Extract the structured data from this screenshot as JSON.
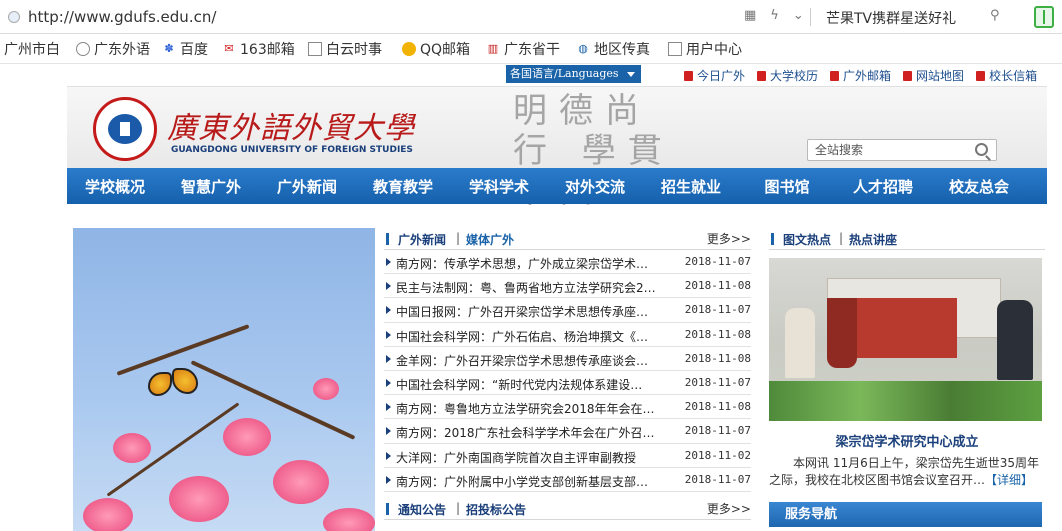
{
  "browser": {
    "url": "http://www.gdufs.edu.cn/",
    "tool_icons": [
      "grid-icon",
      "bolt-icon",
      "chevron-down-icon"
    ],
    "promo_text": "芒果TV携群星送好礼"
  },
  "bookmarks": [
    {
      "label": "广州市白",
      "icon": "page-icon"
    },
    {
      "label": "广东外语",
      "icon": "globe-icon"
    },
    {
      "label": "百度",
      "icon": "paw-icon"
    },
    {
      "label": "163邮箱",
      "icon": "mail163-icon"
    },
    {
      "label": "白云时事",
      "icon": "page-icon"
    },
    {
      "label": "QQ邮箱",
      "icon": "qq-icon"
    },
    {
      "label": "广东省干",
      "icon": "book-icon"
    },
    {
      "label": "地区传真",
      "icon": "swirl-icon"
    },
    {
      "label": "用户中心",
      "icon": "page-icon"
    }
  ],
  "site": {
    "lang_select": "各国语言/Languages",
    "toplinks": [
      "今日广外",
      "大学校历",
      "广外邮箱",
      "网站地图",
      "校长信箱"
    ],
    "logo_cn": "廣東外語外貿大學",
    "logo_en": "GUANGDONG UNIVERSITY OF FOREIGN STUDIES",
    "motto": "明德尚行 學貫中西",
    "search_placeholder": "全站搜索",
    "nav": [
      "学校概况",
      "智慧广外",
      "广外新闻",
      "教育教学",
      "学科学术",
      "对外交流",
      "招生就业",
      "图书馆",
      "人才招聘",
      "校友总会"
    ]
  },
  "news": {
    "tab1": "广外新闻",
    "tab2": "媒体广外",
    "more": "更多>>",
    "items": [
      {
        "title": "南方网：传承学术思想，广外成立梁宗岱学术…",
        "date": "2018-11-07"
      },
      {
        "title": "民主与法制网：粤、鲁两省地方立法学研究会2…",
        "date": "2018-11-08"
      },
      {
        "title": "中国日报网：广外召开梁宗岱学术思想传承座…",
        "date": "2018-11-07"
      },
      {
        "title": "中国社会科学网：广外石佑启、杨治坤撰文《…",
        "date": "2018-11-08"
      },
      {
        "title": "金羊网：广外召开梁宗岱学术思想传承座谈会…",
        "date": "2018-11-08"
      },
      {
        "title": "中国社会科学网：“新时代党内法规体系建设…",
        "date": "2018-11-07"
      },
      {
        "title": "南方网：粤鲁地方立法学研究会2018年年会在…",
        "date": "2018-11-08"
      },
      {
        "title": "南方网：2018广东社会科学学术年会在广外召…",
        "date": "2018-11-07"
      },
      {
        "title": "大洋网：广外南国商学院首次自主评审副教授",
        "date": "2018-11-02"
      },
      {
        "title": "南方网：广外附属中小学党支部创新基层支部…",
        "date": "2018-11-07"
      }
    ],
    "notice_tab1": "通知公告",
    "notice_tab2": "招投标公告",
    "notice_more": "更多>>"
  },
  "hot": {
    "tab1": "图文热点",
    "tab2": "热点讲座",
    "title": "梁宗岱学术研究中心成立",
    "summary": "本网讯 11月6日上午，梁宗岱先生逝世35周年之际，我校在北校区图书馆会议室召开…",
    "detail": "【详细】",
    "service_nav": "服务导航"
  },
  "colors": {
    "brand_blue": "#1a63a8",
    "brand_red": "#b81a1a",
    "nav_blue": "#1560ac"
  }
}
